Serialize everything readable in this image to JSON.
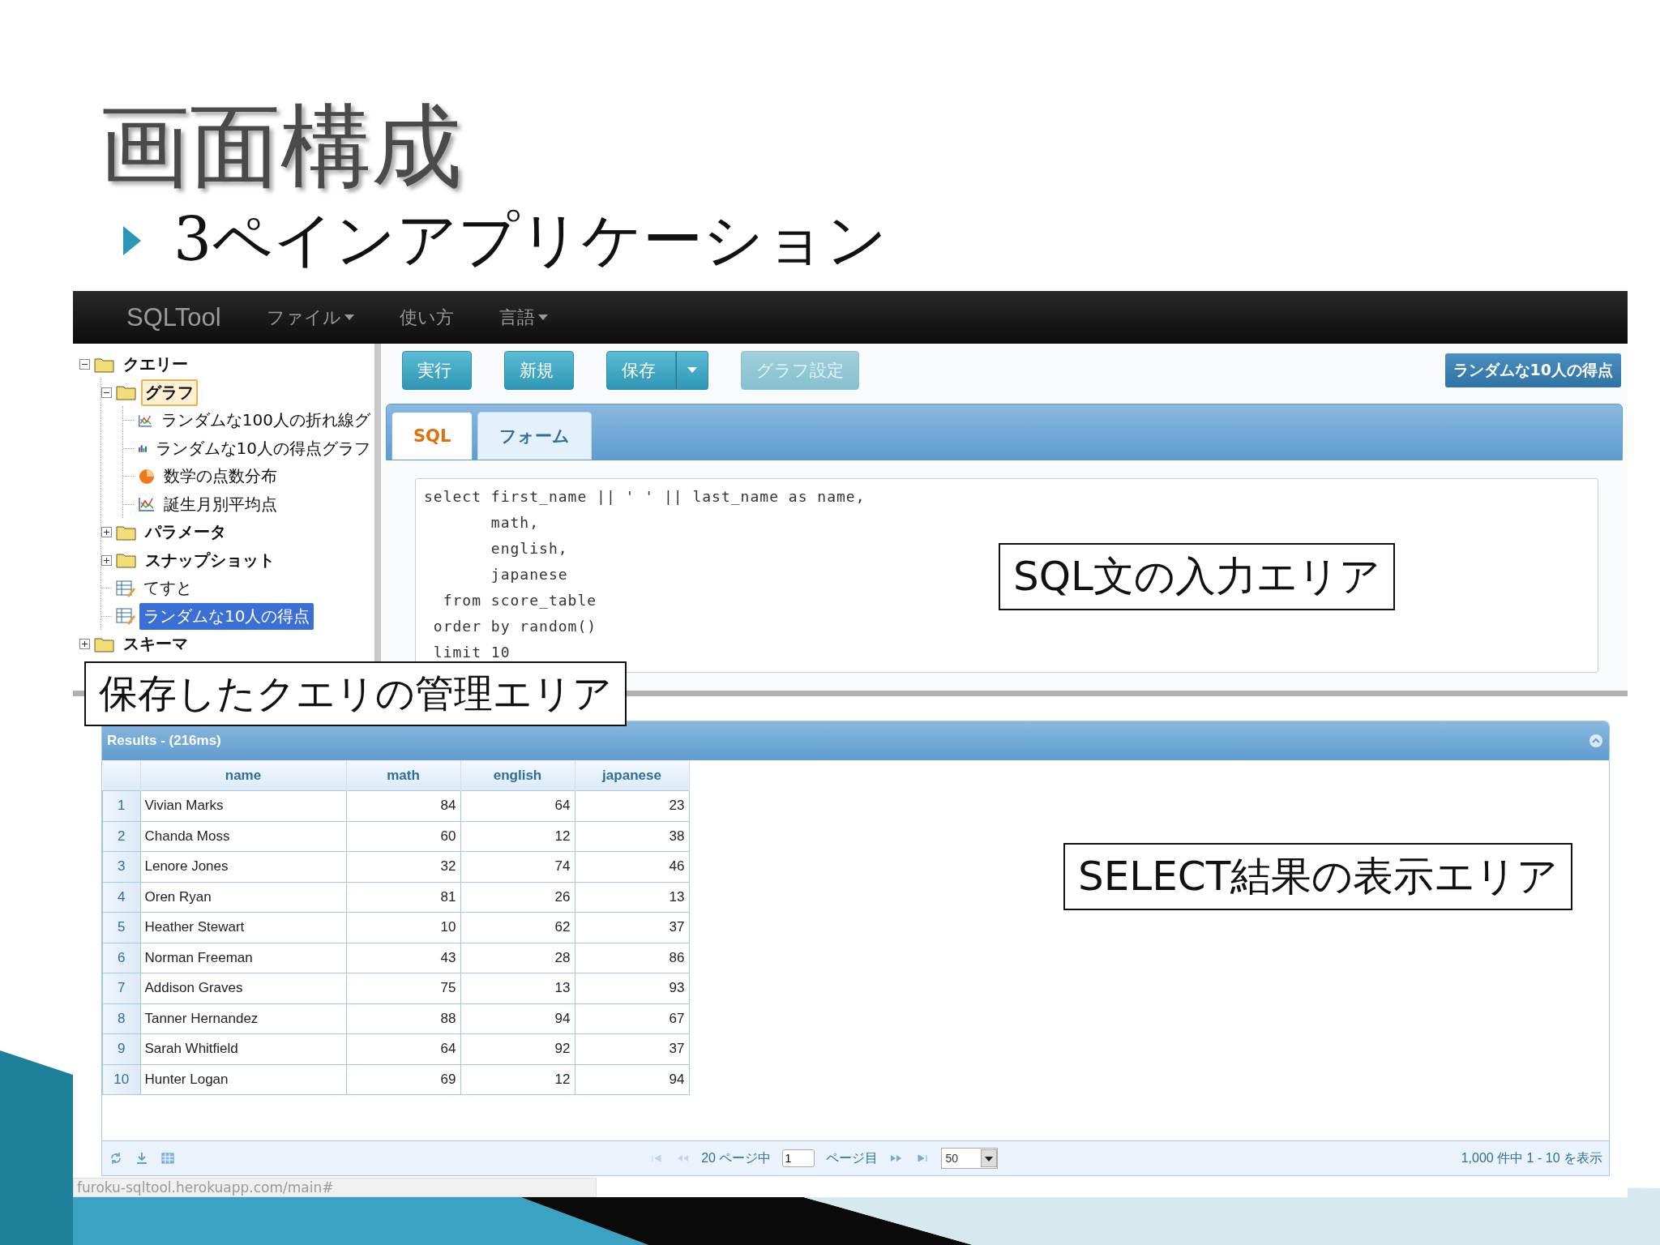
{
  "slide": {
    "title": "画面構成",
    "bullet": "3ペインアプリケーション"
  },
  "app": {
    "brand": "SQLTool",
    "menus": [
      {
        "label": "ファイル",
        "dropdown": true
      },
      {
        "label": "使い方",
        "dropdown": false
      },
      {
        "label": "言語",
        "dropdown": true
      }
    ],
    "tree": [
      {
        "label": "クエリー",
        "kind": "folder",
        "expanded": true,
        "selected": false,
        "focused": false,
        "children": [
          {
            "label": "グラフ",
            "kind": "folder",
            "expanded": true,
            "selected": false,
            "focused": true,
            "children": [
              {
                "label": "ランダムな100人の折れ線グ",
                "kind": "line-chart",
                "selected": false,
                "focused": false
              },
              {
                "label": "ランダムな10人の得点グラフ",
                "kind": "bar-chart",
                "selected": false,
                "focused": false
              },
              {
                "label": "数学の点数分布",
                "kind": "pie-chart",
                "selected": false,
                "focused": false
              },
              {
                "label": "誕生月別平均点",
                "kind": "line-chart",
                "selected": false,
                "focused": false
              }
            ]
          },
          {
            "label": "パラメータ",
            "kind": "folder",
            "expanded": false,
            "selected": false,
            "focused": false
          },
          {
            "label": "スナップショット",
            "kind": "folder",
            "expanded": false,
            "selected": false,
            "focused": false
          },
          {
            "label": "てすと",
            "kind": "query",
            "selected": false,
            "focused": false
          },
          {
            "label": "ランダムな10人の得点",
            "kind": "query",
            "selected": true,
            "focused": false
          }
        ]
      },
      {
        "label": "スキーマ",
        "kind": "folder",
        "expanded": false,
        "selected": false,
        "focused": false
      }
    ],
    "toolbar": [
      {
        "label": "実行",
        "disabled": false,
        "split": false
      },
      {
        "label": "新規",
        "disabled": false,
        "split": false
      },
      {
        "label": "保存",
        "disabled": false,
        "split": true
      },
      {
        "label": "グラフ設定",
        "disabled": true,
        "split": false
      }
    ],
    "query_title": "ランダムな10人の得点",
    "tabs": [
      {
        "label": "SQL",
        "selected": true
      },
      {
        "label": "フォーム",
        "selected": false
      }
    ],
    "editor_lines": [
      "select first_name || ' ' || last_name as name,",
      "       math,",
      "       english,",
      "       japanese",
      "  from score_table",
      " order by random()",
      " limit 10"
    ],
    "results": {
      "title": "Results - (216ms)",
      "columns": [
        "",
        "name",
        "math",
        "english",
        "japanese"
      ],
      "rows": [
        [
          "1",
          "Vivian Marks",
          "84",
          "64",
          "23"
        ],
        [
          "2",
          "Chanda Moss",
          "60",
          "12",
          "38"
        ],
        [
          "3",
          "Lenore Jones",
          "32",
          "74",
          "46"
        ],
        [
          "4",
          "Oren Ryan",
          "81",
          "26",
          "13"
        ],
        [
          "5",
          "Heather Stewart",
          "10",
          "62",
          "37"
        ],
        [
          "6",
          "Norman Freeman",
          "43",
          "28",
          "86"
        ],
        [
          "7",
          "Addison Graves",
          "75",
          "13",
          "93"
        ],
        [
          "8",
          "Tanner Hernandez",
          "88",
          "94",
          "67"
        ],
        [
          "9",
          "Sarah Whitfield",
          "64",
          "92",
          "37"
        ],
        [
          "10",
          "Hunter Logan",
          "69",
          "12",
          "94"
        ]
      ],
      "pager": {
        "total_pages": "20 ページ中",
        "page": "1",
        "page_suffix": "ページ目",
        "page_size": "50",
        "summary": "1,000 件中 1 - 10 を表示"
      }
    },
    "status_url": "furoku-sqltool.herokuapp.com/main#"
  },
  "annotations": [
    {
      "kind": "tree",
      "text": "保存したクエリの管理エリア"
    },
    {
      "kind": "editor",
      "text": "SQL文の入力エリア"
    },
    {
      "kind": "results",
      "text": "SELECT結果の表示エリア"
    }
  ]
}
